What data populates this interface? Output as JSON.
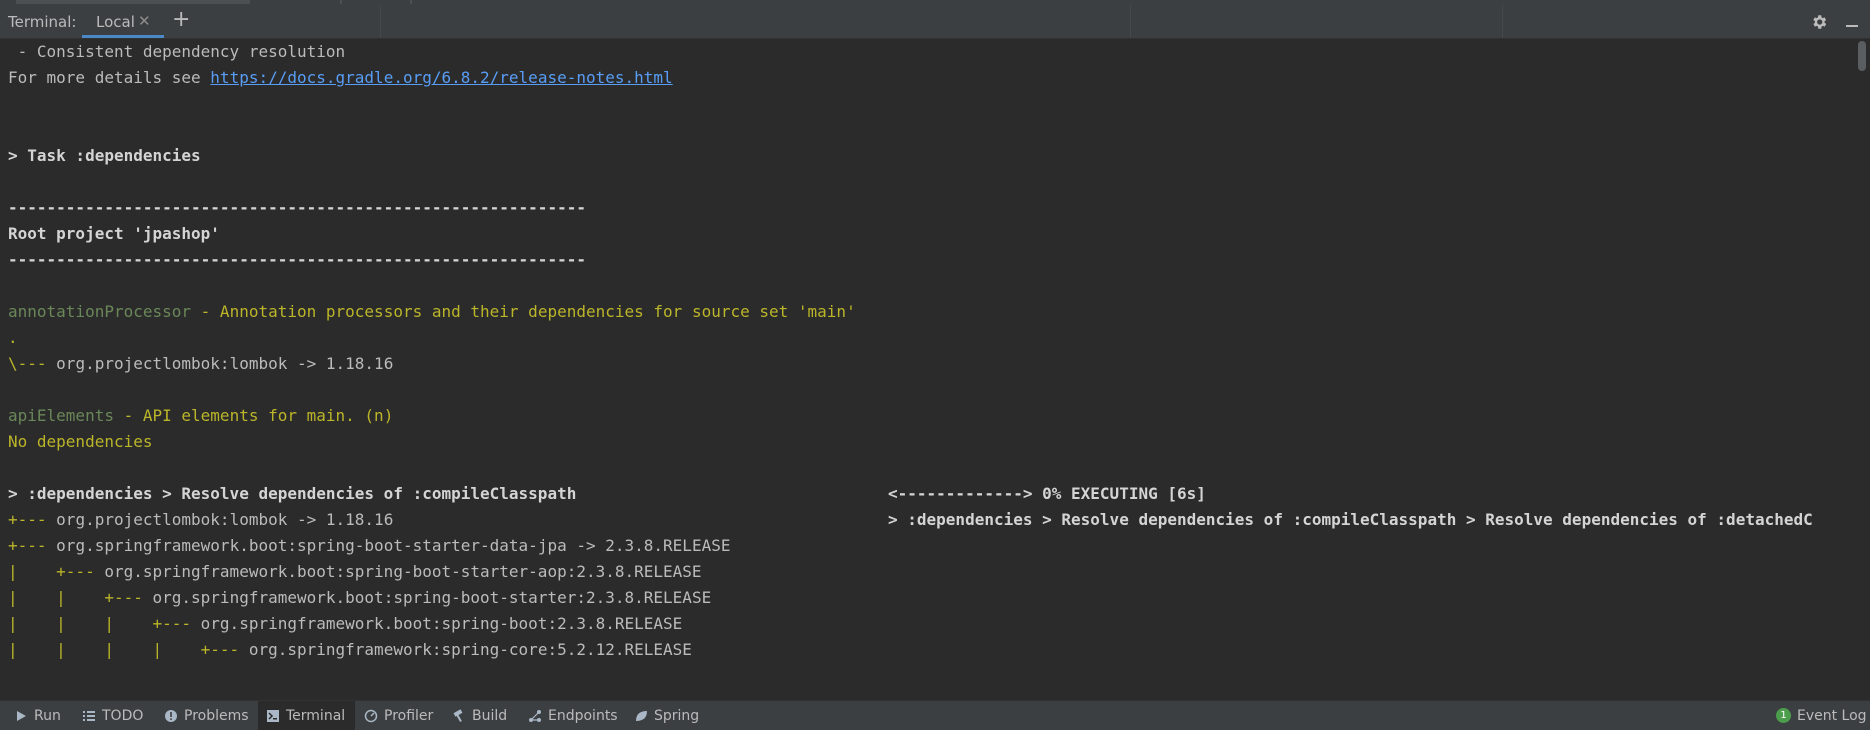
{
  "header": {
    "title": "Terminal:",
    "tab_label": "Local",
    "tab_close": "✕",
    "add_tab": "+"
  },
  "terminal": {
    "lines": [
      " - Consistent dependency resolution",
      "",
      "For more details see ",
      "https://docs.gradle.org/6.8.2/release-notes.html",
      "> Task :dependencies",
      "------------------------------------------------------------",
      "Root project 'jpashop'",
      "------------------------------------------------------------",
      "annotationProcessor",
      " - Annotation processors and their dependencies for source set 'main'",
      ".",
      "\\--- ",
      "org.projectlombok:lombok -> 1.18.16",
      "apiElements",
      " - API elements for main. (n)",
      "No dependencies",
      "> :dependencies > Resolve dependencies of :compileClasspath",
      "<-------------> 0% EXECUTING [6s]",
      "+--- ",
      "org.projectlombok:lombok -> 1.18.16",
      "> :dependencies > Resolve dependencies of :compileClasspath > Resolve dependencies of :detachedC",
      "+--- ",
      "org.springframework.boot:spring-boot-starter-data-jpa -> 2.3.8.RELEASE",
      "|    +--- ",
      "org.springframework.boot:spring-boot-starter-aop:2.3.8.RELEASE",
      "|    |    +--- ",
      "org.springframework.boot:spring-boot-starter:2.3.8.RELEASE",
      "|    |    |    +--- ",
      "org.springframework.boot:spring-boot:2.3.8.RELEASE",
      "|    |    |    |    +--- ",
      "org.springframework:spring-core:5.2.12.RELEASE"
    ]
  },
  "statusbar": {
    "run": "Run",
    "todo": "TODO",
    "problems": "Problems",
    "terminal": "Terminal",
    "profiler": "Profiler",
    "build": "Build",
    "endpoints": "Endpoints",
    "spring": "Spring",
    "event_log": "Event Log",
    "event_count": "1"
  },
  "icons": {
    "gear": "gear-icon",
    "minimize": "minimize-icon",
    "run": "play-icon",
    "todo": "list-icon",
    "problems": "warning-icon",
    "terminal": "terminal-icon",
    "profiler": "profiler-icon",
    "build": "hammer-icon",
    "endpoints": "endpoints-icon",
    "spring": "spring-leaf-icon"
  },
  "colors": {
    "background": "#2b2b2b",
    "panel": "#3c3f41",
    "accent": "#4a88c7",
    "link": "#589df6",
    "green": "#6a8759",
    "yellow": "#bbb529"
  }
}
